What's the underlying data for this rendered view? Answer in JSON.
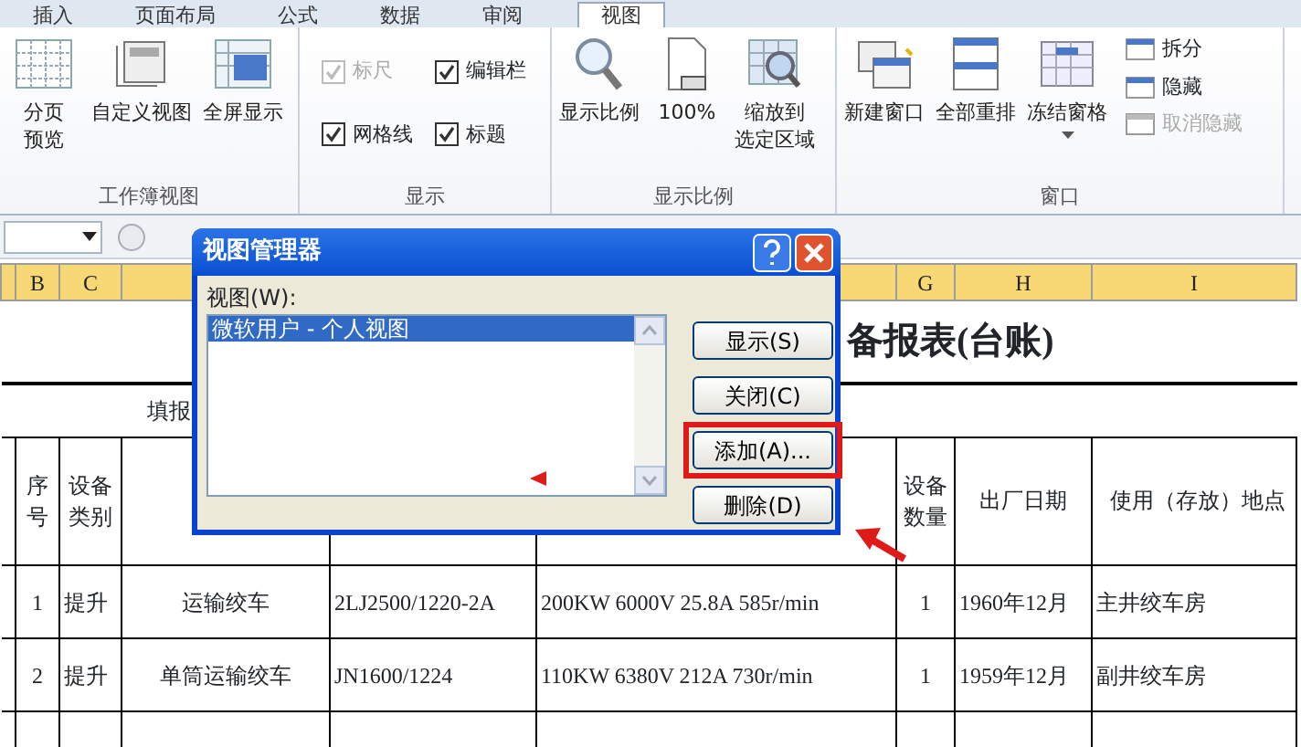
{
  "ribbon_tabs": [
    {
      "label": "插入",
      "selected": false
    },
    {
      "label": "页面布局",
      "selected": false
    },
    {
      "label": "公式",
      "selected": false
    },
    {
      "label": "数据",
      "selected": false
    },
    {
      "label": "审阅",
      "selected": false
    },
    {
      "label": "视图",
      "selected": true
    }
  ],
  "ribbon_groups": [
    {
      "title": "工作簿视图",
      "items": [
        {
          "kind": "large",
          "lines": [
            "分页",
            "预览"
          ]
        },
        {
          "kind": "large",
          "lines": [
            "自定义视图"
          ]
        },
        {
          "kind": "large",
          "lines": [
            "全屏显示"
          ]
        }
      ]
    },
    {
      "title": "显示",
      "items": [
        {
          "kind": "check",
          "label": "标尺",
          "checked": true,
          "disabled": true
        },
        {
          "kind": "check",
          "label": "编辑栏",
          "checked": true,
          "disabled": false
        },
        {
          "kind": "check",
          "label": "网格线",
          "checked": true,
          "disabled": false
        },
        {
          "kind": "check",
          "label": "标题",
          "checked": true,
          "disabled": false
        }
      ]
    },
    {
      "title": "显示比例",
      "items": [
        {
          "kind": "large",
          "lines": [
            "显示比例"
          ]
        },
        {
          "kind": "large",
          "lines": [
            "100%"
          ]
        },
        {
          "kind": "large",
          "lines": [
            "缩放到",
            "选定区域"
          ]
        }
      ]
    },
    {
      "title": "窗口",
      "items": [
        {
          "kind": "large",
          "lines": [
            "新建窗口"
          ]
        },
        {
          "kind": "large",
          "lines": [
            "全部重排"
          ]
        },
        {
          "kind": "large",
          "lines": [
            "冻结窗格"
          ],
          "dropdown": true
        },
        {
          "kind": "small",
          "label": "拆分",
          "disabled": false
        },
        {
          "kind": "small",
          "label": "隐藏",
          "disabled": false
        },
        {
          "kind": "small",
          "label": "取消隐藏",
          "disabled": true
        }
      ]
    }
  ],
  "sheet": {
    "column_headers": [
      "B",
      "C",
      "G",
      "H",
      "I"
    ],
    "title_text": "备报表(台账)",
    "fill_label": "填报",
    "header_row": [
      "序号",
      "设备类别",
      "设备数量",
      "出厂日期",
      "使用（存放）地点"
    ],
    "rows": [
      [
        "1",
        "提升",
        "运输绞车",
        "2LJ2500/1220-2A",
        "200KW  6000V 25.8A 585r/min",
        "1",
        "1960年12月",
        "主井绞车房"
      ],
      [
        "2",
        "提升",
        "单筒运输绞车",
        "JN1600/1224",
        "110KW  6380V 212A 730r/min",
        "1",
        "1959年12月",
        "副井绞车房"
      ]
    ]
  },
  "dialog": {
    "title": "视图管理器",
    "list_label": "视图(W):",
    "views": [
      {
        "label": "微软用户 - 个人视图",
        "selected": true
      }
    ],
    "buttons": [
      {
        "label": "显示(S)",
        "highlighted": false
      },
      {
        "label": "关闭(C)",
        "highlighted": false
      },
      {
        "label": "添加(A)...",
        "highlighted": true
      },
      {
        "label": "删除(D)",
        "highlighted": false
      }
    ]
  }
}
